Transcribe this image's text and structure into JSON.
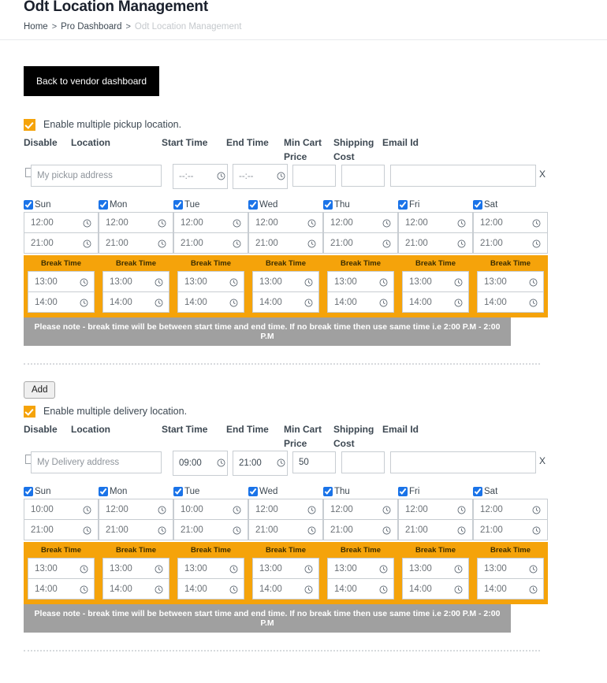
{
  "header": {
    "title": "Odt Location Management",
    "breadcrumb": [
      {
        "label": "Home",
        "current": false
      },
      {
        "label": "Pro Dashboard",
        "current": false
      },
      {
        "label": "Odt Location Management",
        "current": true
      }
    ],
    "separator": ">"
  },
  "back_button": {
    "label": "Back to vendor dashboard"
  },
  "column_headers": {
    "disable": "Disable",
    "location": "Location",
    "start_time": "Start Time",
    "end_time": "End Time",
    "min_cart_price": "Min Cart\nPrice",
    "shipping_cost": "Shipping\nCost",
    "email_id": "Email Id"
  },
  "break_title": "Break Time",
  "note": "Please note - break time will be between start time and end time. If no break time then use same time i.e 2:00 P.M - 2:00 P.M",
  "remove_label": "X",
  "add_button": {
    "label": "Add"
  },
  "colors": {
    "accent_orange": "#f5a30a",
    "note_gray": "#a0a0a0",
    "checkbox_blue": "#1a73e8",
    "button_black": "#000000"
  },
  "pickup": {
    "enable_label": "Enable multiple pickup location.",
    "enabled": true,
    "disable_checked": false,
    "location_value": "",
    "location_placeholder": "My pickup address",
    "start_time_value": "",
    "start_time_placeholder": "--:--",
    "end_time_value": "",
    "end_time_placeholder": "--:--",
    "min_cart_price_value": "",
    "shipping_cost_value": "",
    "email_id_value": "",
    "days": [
      {
        "label": "Sun",
        "checked": true,
        "open": "12:00",
        "close": "21:00",
        "break_start": "13:00",
        "break_end": "14:00"
      },
      {
        "label": "Mon",
        "checked": true,
        "open": "12:00",
        "close": "21:00",
        "break_start": "13:00",
        "break_end": "14:00"
      },
      {
        "label": "Tue",
        "checked": true,
        "open": "12:00",
        "close": "21:00",
        "break_start": "13:00",
        "break_end": "14:00"
      },
      {
        "label": "Wed",
        "checked": true,
        "open": "12:00",
        "close": "21:00",
        "break_start": "13:00",
        "break_end": "14:00"
      },
      {
        "label": "Thu",
        "checked": true,
        "open": "12:00",
        "close": "21:00",
        "break_start": "13:00",
        "break_end": "14:00"
      },
      {
        "label": "Fri",
        "checked": true,
        "open": "12:00",
        "close": "21:00",
        "break_start": "13:00",
        "break_end": "14:00"
      },
      {
        "label": "Sat",
        "checked": true,
        "open": "12:00",
        "close": "21:00",
        "break_start": "13:00",
        "break_end": "14:00"
      }
    ]
  },
  "delivery": {
    "enable_label": "Enable multiple delivery location.",
    "enabled": true,
    "disable_checked": false,
    "location_value": "",
    "location_placeholder": "My Delivery address",
    "start_time_value": "09:00",
    "start_time_placeholder": "--:--",
    "end_time_value": "21:00",
    "end_time_placeholder": "--:--",
    "min_cart_price_value": "50",
    "shipping_cost_value": "",
    "email_id_value": "",
    "days": [
      {
        "label": "Sun",
        "checked": true,
        "open": "10:00",
        "close": "21:00",
        "break_start": "13:00",
        "break_end": "14:00"
      },
      {
        "label": "Mon",
        "checked": true,
        "open": "12:00",
        "close": "21:00",
        "break_start": "13:00",
        "break_end": "14:00"
      },
      {
        "label": "Tue",
        "checked": true,
        "open": "10:00",
        "close": "21:00",
        "break_start": "13:00",
        "break_end": "14:00"
      },
      {
        "label": "Wed",
        "checked": true,
        "open": "12:00",
        "close": "21:00",
        "break_start": "13:00",
        "break_end": "14:00"
      },
      {
        "label": "Thu",
        "checked": true,
        "open": "12:00",
        "close": "21:00",
        "break_start": "13:00",
        "break_end": "14:00"
      },
      {
        "label": "Fri",
        "checked": true,
        "open": "12:00",
        "close": "21:00",
        "break_start": "13:00",
        "break_end": "14:00"
      },
      {
        "label": "Sat",
        "checked": true,
        "open": "12:00",
        "close": "21:00",
        "break_start": "13:00",
        "break_end": "14:00"
      }
    ]
  }
}
